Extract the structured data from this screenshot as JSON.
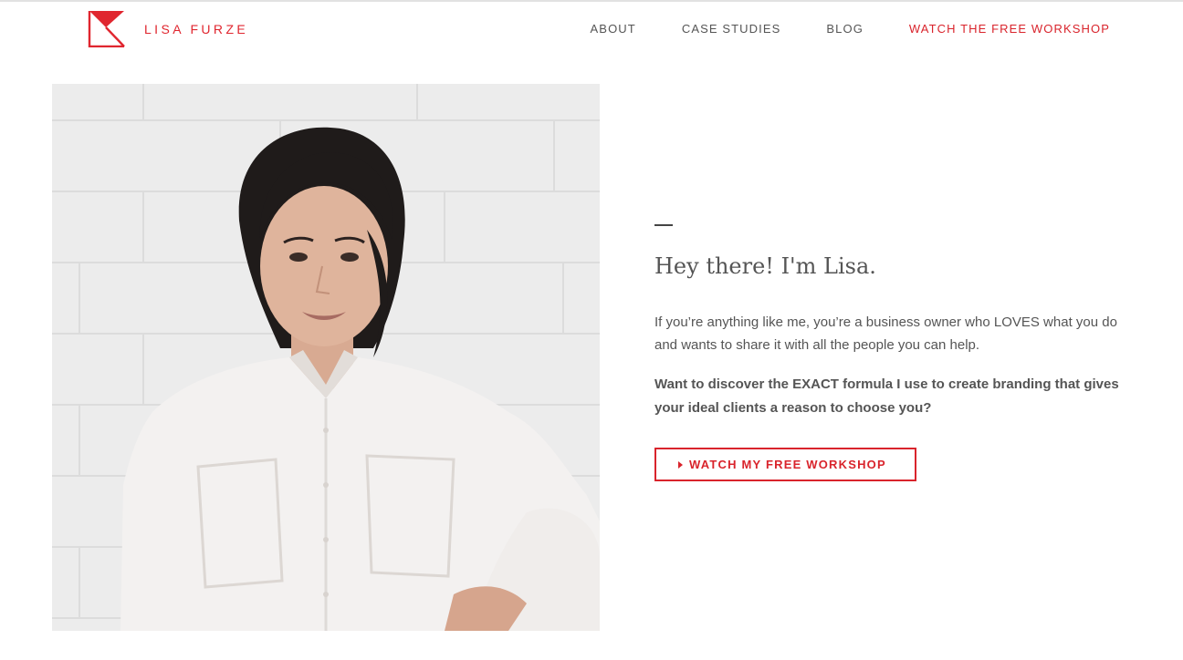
{
  "brand": {
    "name": "LISA FURZE",
    "logo_icon": "k-flag-logo-icon",
    "accent_color": "#d9242c"
  },
  "nav": {
    "items": [
      {
        "label": "ABOUT"
      },
      {
        "label": "CASE STUDIES"
      },
      {
        "label": "BLOG"
      },
      {
        "label": "WATCH THE FREE WORKSHOP"
      }
    ]
  },
  "hero": {
    "photo_alt": "portrait-photo",
    "headline": "Hey there! I'm Lisa.",
    "intro": "If you’re anything like me, you’re a business owner who LOVES what you do and wants to share it with all the people you can help.",
    "pitch": "Want to discover the EXACT formula I use to create branding that gives your ideal clients a reason to choose you?",
    "cta_label": "WATCH MY FREE WORKSHOP",
    "cta_icon": "caret-right-icon"
  }
}
